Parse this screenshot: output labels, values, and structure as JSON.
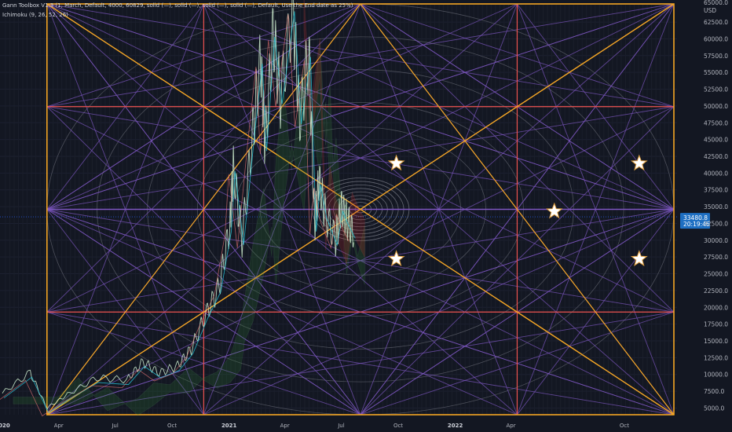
{
  "indicators": [
    "Gann Toolbox V1.3 (1, March, Default, 4000, 60829, solid (—), solid (—), solid (—), solid (—), Default, Use the End date as 25%)",
    "Ichimoku (9, 26, 52, 26)"
  ],
  "currency": "USD",
  "top_tick": "65000.0",
  "last_price": "33480.8",
  "countdown": "20:19:46",
  "colors": {
    "background": "#131722",
    "gann_orange": "#f5a623",
    "gann_purple": "#7e57c2",
    "gann_red": "#ef5350",
    "price_badge": "#1e6fc2"
  },
  "chart_data": {
    "type": "line",
    "title": "",
    "xlabel": "",
    "ylabel": "",
    "ylim": [
      4000,
      65200
    ],
    "y_ticks": [
      5000,
      7500,
      10000,
      12500,
      15000,
      17500,
      20000,
      22500,
      25000,
      27500,
      30000,
      32500,
      35000,
      37500,
      40000,
      42500,
      45000,
      47500,
      50000,
      52500,
      55000,
      57500,
      60000,
      62500
    ],
    "x_ticks": [
      {
        "label": "2020",
        "date": "2020-01-01",
        "bold": true
      },
      {
        "label": "Apr",
        "date": "2020-04-01",
        "bold": false
      },
      {
        "label": "Jul",
        "date": "2020-07-01",
        "bold": false
      },
      {
        "label": "Oct",
        "date": "2020-10-01",
        "bold": false
      },
      {
        "label": "2021",
        "date": "2021-01-01",
        "bold": true
      },
      {
        "label": "Apr",
        "date": "2021-04-01",
        "bold": false
      },
      {
        "label": "Jul",
        "date": "2021-07-01",
        "bold": false
      },
      {
        "label": "Oct",
        "date": "2021-10-01",
        "bold": false
      },
      {
        "label": "2022",
        "date": "2022-01-01",
        "bold": true
      },
      {
        "label": "Apr",
        "date": "2022-04-01",
        "bold": false
      },
      {
        "label": "Oct",
        "date": "2022-10-01",
        "bold": false
      }
    ],
    "price_series": {
      "name": "",
      "x": [
        "2020-01-01",
        "2020-02-15",
        "2020-03-13",
        "2020-04-15",
        "2020-06-01",
        "2020-07-20",
        "2020-08-15",
        "2020-09-10",
        "2020-10-10",
        "2020-11-01",
        "2020-11-25",
        "2020-12-16",
        "2021-01-02",
        "2021-01-08",
        "2021-01-22",
        "2021-02-08",
        "2021-02-21",
        "2021-02-28",
        "2021-03-13",
        "2021-03-25",
        "2021-04-14",
        "2021-04-25",
        "2021-05-10",
        "2021-05-19",
        "2021-05-26",
        "2021-06-05",
        "2021-06-22",
        "2021-07-01",
        "2021-07-10",
        "2021-07-21"
      ],
      "y": [
        7200,
        10300,
        5000,
        7000,
        9500,
        9200,
        11900,
        10200,
        11300,
        13800,
        19100,
        23000,
        32000,
        41000,
        30000,
        46000,
        57000,
        44000,
        61000,
        51000,
        64800,
        48000,
        58000,
        32000,
        39000,
        34000,
        30000,
        35000,
        33000,
        31000
      ]
    },
    "gann": {
      "start_date": "2020-03-13",
      "end_date": "2022-12-20",
      "low": 4000,
      "high": 65200,
      "levels": [
        0.25,
        0.5,
        0.75
      ],
      "stars": [
        {
          "date": "2021-09-28",
          "price": 41450
        },
        {
          "date": "2022-10-25",
          "price": 41450
        },
        {
          "date": "2021-09-28",
          "price": 27200
        },
        {
          "date": "2022-10-25",
          "price": 27200
        },
        {
          "date": "2022-06-10",
          "price": 34300
        }
      ]
    }
  }
}
